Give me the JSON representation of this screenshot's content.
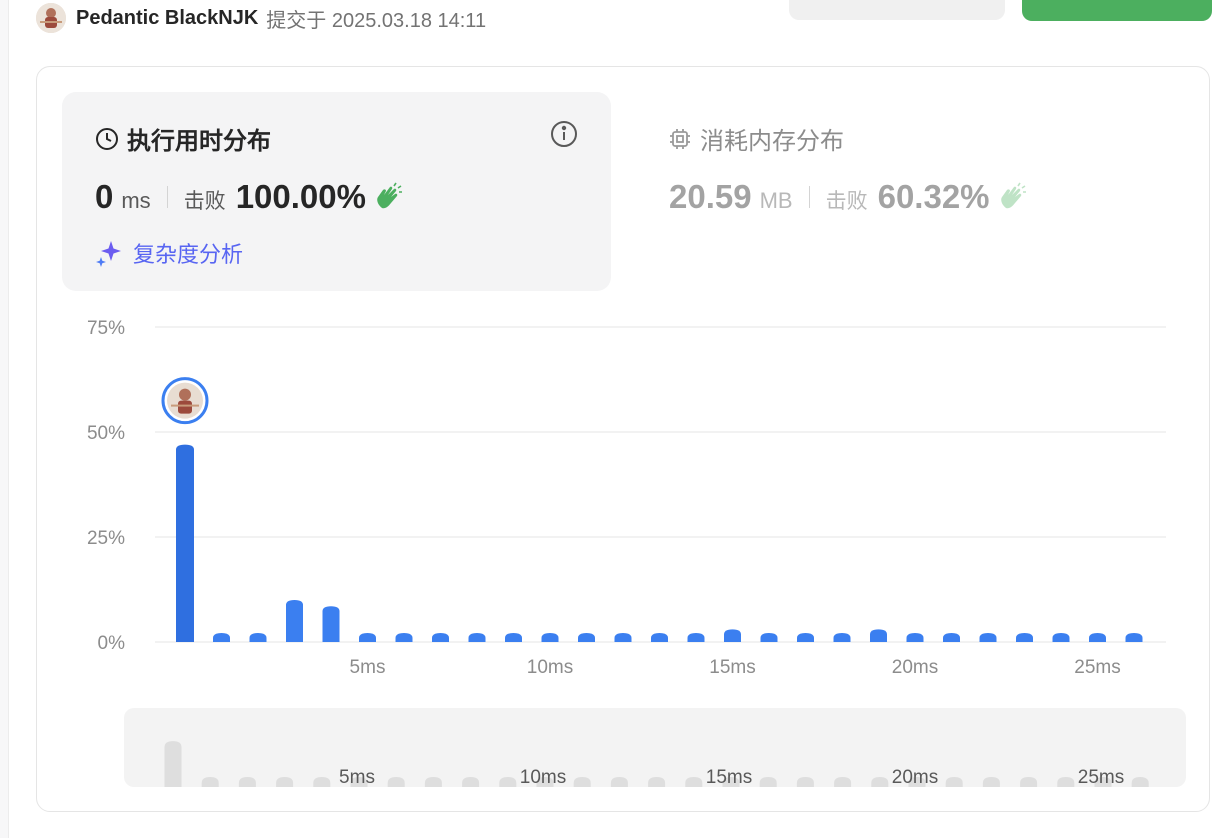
{
  "header": {
    "username": "Pedantic BlackNJK",
    "submitted": "提交于 2025.03.18 14:11"
  },
  "runtime": {
    "title": "执行用时分布",
    "value": "0",
    "unit": "ms",
    "beat_label": "击败",
    "beat_pct": "100.00%",
    "complexity_link": "复杂度分析"
  },
  "memory": {
    "title": "消耗内存分布",
    "value": "20.59",
    "unit": "MB",
    "beat_label": "击败",
    "beat_pct": "60.32%"
  },
  "colors": {
    "bar": "#3b7ff0",
    "bar_user": "#2f6fe0",
    "accent_green": "#4caf5f",
    "link": "#5865f2"
  },
  "chart_data": {
    "type": "bar",
    "ytick_labels": [
      "0%",
      "25%",
      "50%",
      "75%"
    ],
    "ylim": [
      0,
      75
    ],
    "yticks": [
      0,
      25,
      50,
      75
    ],
    "xtick_labels": [
      "5ms",
      "10ms",
      "15ms",
      "20ms",
      "25ms"
    ],
    "xticks": [
      5,
      10,
      15,
      20,
      25
    ],
    "x": [
      0,
      1,
      2,
      3,
      4,
      5,
      6,
      7,
      8,
      9,
      10,
      11,
      12,
      13,
      14,
      15,
      16,
      17,
      18,
      19,
      20,
      21,
      22,
      23,
      24,
      25,
      26
    ],
    "values": [
      47,
      1.5,
      1.5,
      10,
      8.5,
      1.5,
      1.5,
      1.5,
      1.5,
      1.5,
      1.5,
      1.5,
      1.5,
      1.5,
      1.5,
      3,
      1.5,
      1.5,
      1.5,
      3,
      1.5,
      1.5,
      1.5,
      1.5,
      1.5,
      1.5,
      1.5
    ],
    "user_bucket": 0,
    "grid": true
  }
}
